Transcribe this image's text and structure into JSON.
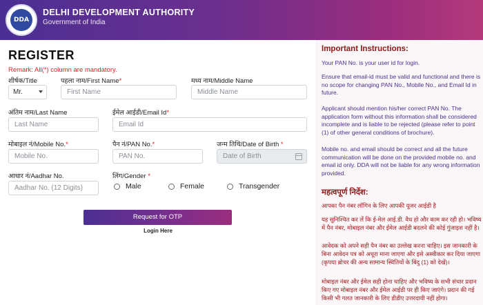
{
  "header": {
    "logo_text": "DDA",
    "org_title": "DELHI DEVELOPMENT AUTHORITY",
    "org_subtitle": "Government of India"
  },
  "form": {
    "title": "REGISTER",
    "remark": "Remark: All(*) column are mandatory.",
    "title_field": {
      "label": "शीर्षक/Title",
      "value": "Mr."
    },
    "first_name": {
      "label": "पहला नाम/First Name",
      "placeholder": "First Name"
    },
    "middle_name": {
      "label": "मध्य नाम/Middle Name",
      "placeholder": "Middle Name"
    },
    "last_name": {
      "label": "अंतिम नाम/Last Name",
      "placeholder": "Last Name"
    },
    "email": {
      "label": "ईमेल आईडी/Email Id",
      "placeholder": "Email Id"
    },
    "mobile": {
      "label": "मोबाइल नं/Mobile No.",
      "placeholder": "Mobile No."
    },
    "pan": {
      "label": "पैन नं/PAN No.",
      "placeholder": "PAN No."
    },
    "dob": {
      "label": "जन्म तिथि/Date of Birth",
      "placeholder": "Date of Birth"
    },
    "aadhar": {
      "label": "आधार नं/Aadhar No.",
      "placeholder": "Aadhar No. (12 Digits)"
    },
    "gender": {
      "label": "लिंग/Gender",
      "options": [
        "Male",
        "Female",
        "Transgender"
      ]
    },
    "required_mark": "*",
    "otp_button": "Request for OTP",
    "login_link": "Login Here"
  },
  "instructions": {
    "title": "Important Instructions:",
    "items": [
      "Your PAN No. is your user id for login.",
      "Ensure that email-id must be valid and functional and there is no scope for changing PAN No., Mobile No., and Email Id in future.",
      "Applicant should mention his/her correct PAN No. The application form without this information shall be considered incomplete and is liable to be rejected (please refer to point (1) of other general conditions of brochure).",
      "Mobile no. and email should be correct and all the future communication will be done on the provided mobile no. and email id only. DDA will not be liable for any wrong information provided."
    ],
    "hindi_title": "महत्वपूर्ण निर्देश:",
    "hindi_items": [
      "आपका पैन नंबर लॉगिन के लिए आपकी यूजर आईडी है",
      "यह सुनिश्चित कर लें कि ई-मेल आई.डी. वैध हो और काम कर रही हो। भविष्य में पैन नंबर, मोबाइल नंबर और ईमेल आईडी बदलने की कोई गुंजाइश नहीं है।",
      "आवेदक को अपने सही पैन नंबर का उल्लेख करना चाहिए। इस जानकारी के बिना आवेदन पत्र को अधूरा माना जाएगा और इसे अस्वीकार कर दिया जाएगा (कृपया ब्रोचर की अन्य सामान्य स्थितियों के बिंदु (1) को देखें)।",
      "मोबाइल नंबर और ईमेल सही होना चाहिए और भविष्य के सभी संचार प्रदान किए गए मोबाइल नंबर और ईमेल आईडी पर ही किए जाएंगे। प्रदान की गई किसी भी गलत जानकारी के लिए डीडीए उत्तरदायी नहीं होगा।"
    ]
  },
  "colors": {
    "header_start": "#4b2f93",
    "header_end": "#b33a7b",
    "required": "#dd2222",
    "instruction_text": "#4a2f8f",
    "instruction_title": "#8b1a1a"
  }
}
